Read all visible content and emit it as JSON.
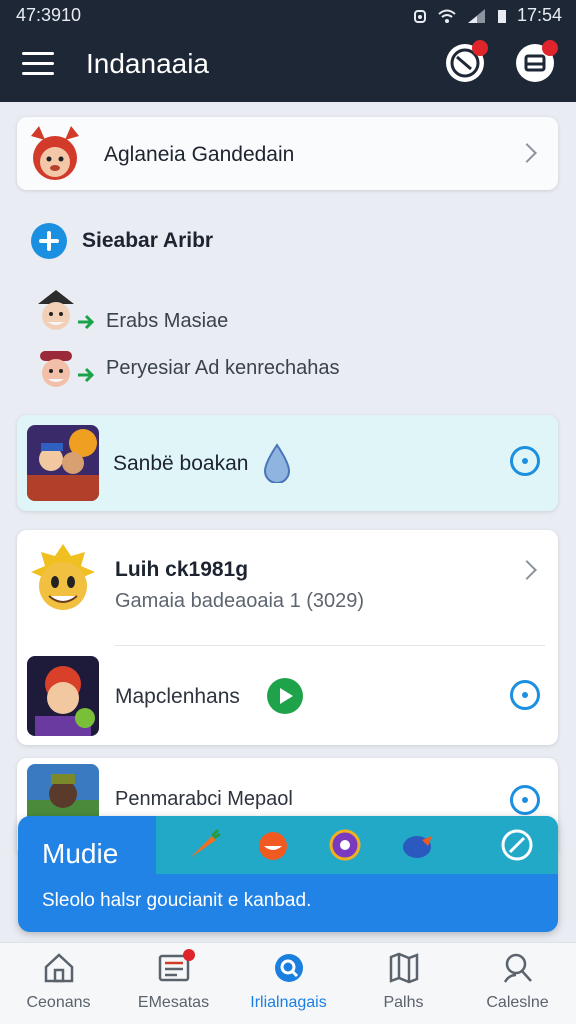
{
  "status_bar": {
    "time_left": "47:3910",
    "time_right": "17:54"
  },
  "app_bar": {
    "title": "Indanaaia"
  },
  "profile_card": {
    "name": "Aglaneia Gandedain"
  },
  "section": {
    "title": "Sieabar Aribr"
  },
  "activity": [
    {
      "label": "Erabs Masiae"
    },
    {
      "label": "Peryesiar Ad kenrechahas"
    }
  ],
  "highlight_item": {
    "label": "Sanbë boakan"
  },
  "group": {
    "title": "Luih ck1981g",
    "subtitle": "Gamaia badeaoaia 1 (3029)",
    "item_label": "Mapclenhans"
  },
  "peek_item": {
    "label": "Penmarabci Mepaol"
  },
  "banner": {
    "title": "Mudie",
    "text": "Sleolo halsr goucianit e kanbad.",
    "color": "#2283e6"
  },
  "nav": [
    {
      "label": "Ceonans",
      "icon": "home-icon"
    },
    {
      "label": "EMesatas",
      "icon": "messages-icon"
    },
    {
      "label": "Irlialnagais",
      "icon": "discover-icon"
    },
    {
      "label": "Palhs",
      "icon": "map-icon"
    },
    {
      "label": "Caleslne",
      "icon": "profile-icon"
    }
  ]
}
